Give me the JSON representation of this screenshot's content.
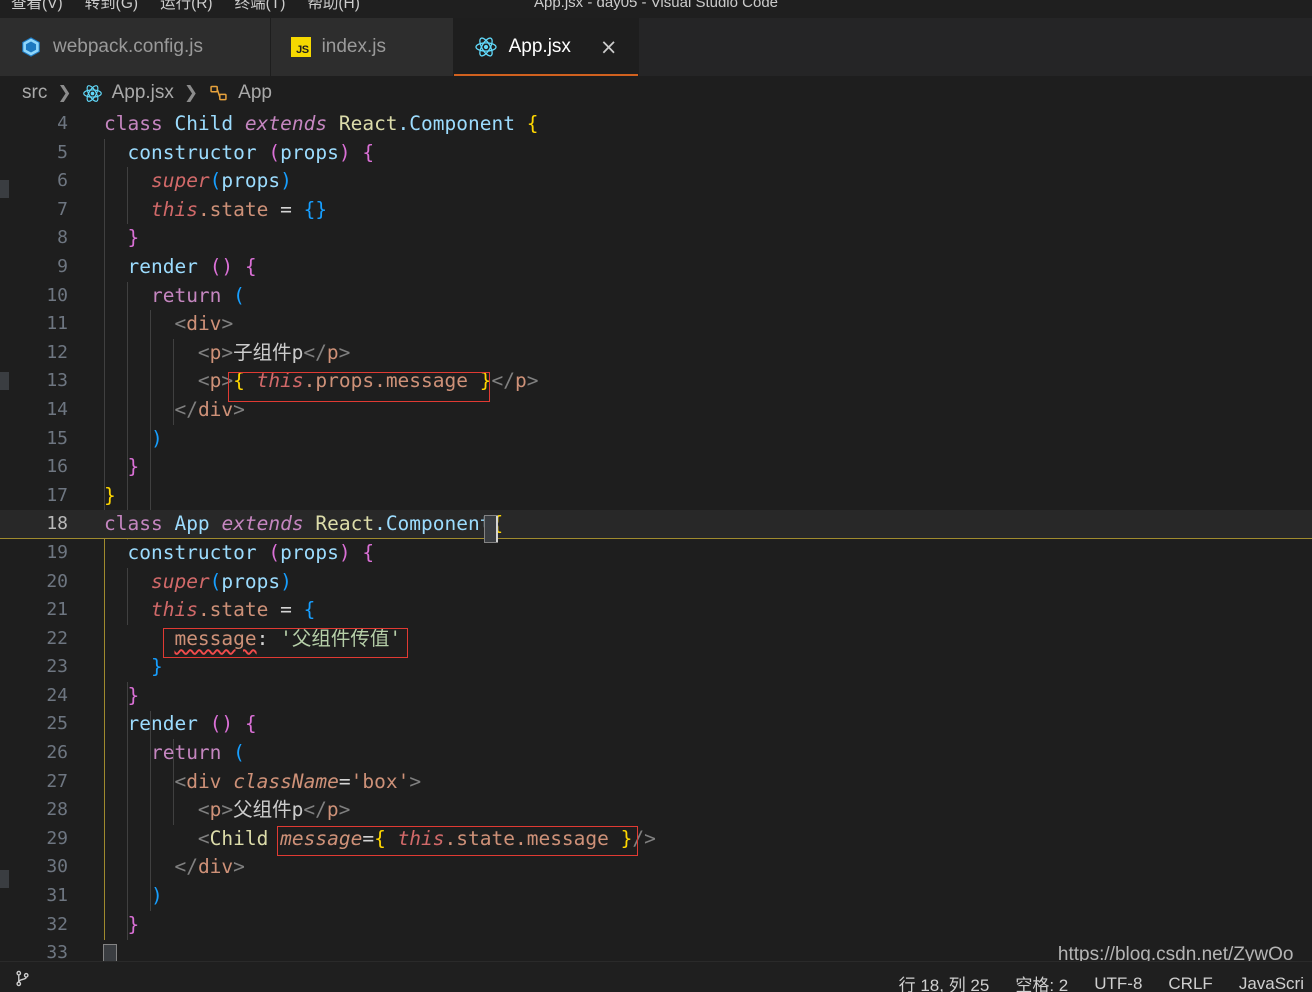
{
  "window": {
    "title": "App.jsx - day05 - Visual Studio Code",
    "menu": [
      {
        "label": "查看(V)"
      },
      {
        "label": "转到(G)"
      },
      {
        "label": "运行(R)"
      },
      {
        "label": "终端(T)"
      },
      {
        "label": "帮助(H)"
      }
    ]
  },
  "tabs": [
    {
      "label": "webpack.config.js",
      "icon": "webpack-icon",
      "active": false
    },
    {
      "label": "index.js",
      "icon": "js-icon",
      "active": false
    },
    {
      "label": "App.jsx",
      "icon": "react-icon",
      "active": true,
      "close": "×"
    }
  ],
  "breadcrumb": {
    "separator": "❯",
    "items": [
      {
        "label": "src",
        "icon": "none"
      },
      {
        "label": "App.jsx",
        "icon": "react-icon"
      },
      {
        "label": "App",
        "icon": "class-symbol-icon"
      }
    ]
  },
  "editor": {
    "first_line": 4,
    "current_line": 18,
    "lines": [
      {
        "n": 4,
        "text": "class Child extends React.Component {"
      },
      {
        "n": 5,
        "text": "  constructor (props) {"
      },
      {
        "n": 6,
        "text": "    super(props)"
      },
      {
        "n": 7,
        "text": "    this.state = {}"
      },
      {
        "n": 8,
        "text": "  }"
      },
      {
        "n": 9,
        "text": "  render () {"
      },
      {
        "n": 10,
        "text": "    return ("
      },
      {
        "n": 11,
        "text": "      <div>"
      },
      {
        "n": 12,
        "text": "        <p>子组件p</p>"
      },
      {
        "n": 13,
        "text": "        <p>{ this.props.message }</p>"
      },
      {
        "n": 14,
        "text": "      </div>"
      },
      {
        "n": 15,
        "text": "    )"
      },
      {
        "n": 16,
        "text": "  }"
      },
      {
        "n": 17,
        "text": "}"
      },
      {
        "n": 18,
        "text": "class App extends React.Component{"
      },
      {
        "n": 19,
        "text": "  constructor (props) {"
      },
      {
        "n": 20,
        "text": "    super(props)"
      },
      {
        "n": 21,
        "text": "    this.state = {"
      },
      {
        "n": 22,
        "text": "      message: '父组件传值'"
      },
      {
        "n": 23,
        "text": "    }"
      },
      {
        "n": 24,
        "text": "  }"
      },
      {
        "n": 25,
        "text": "  render () {"
      },
      {
        "n": 26,
        "text": "    return ("
      },
      {
        "n": 27,
        "text": "      <div className='box'>"
      },
      {
        "n": 28,
        "text": "        <p>父组件p</p>"
      },
      {
        "n": 29,
        "text": "        <Child message={ this.state.message }/>"
      },
      {
        "n": 30,
        "text": "      </div>"
      },
      {
        "n": 31,
        "text": "    )"
      },
      {
        "n": 32,
        "text": "  }"
      },
      {
        "n": 33,
        "text": "}"
      }
    ],
    "annotations": [
      {
        "target_line": 13,
        "text": "{ this.props.message }"
      },
      {
        "target_line": 22,
        "text": "message: '父组件传值'"
      },
      {
        "target_line": 29,
        "text": "message={ this.state.message }"
      }
    ]
  },
  "status": {
    "branch_icon": "source-control-branch-icon",
    "cursor_position": "行 18, 列 25",
    "indentation": "空格: 2",
    "encoding": "UTF-8",
    "eol": "CRLF",
    "language": "JavaScri"
  },
  "watermark": {
    "text": "https://blog.csdn.net/ZywOo_"
  },
  "colors": {
    "editor_bg": "#1e1e1e",
    "tabbar_bg": "#252526",
    "active_tab_border": "#d1611f",
    "annotation_red": "#e03a33",
    "current_line_bg": "#282828"
  }
}
